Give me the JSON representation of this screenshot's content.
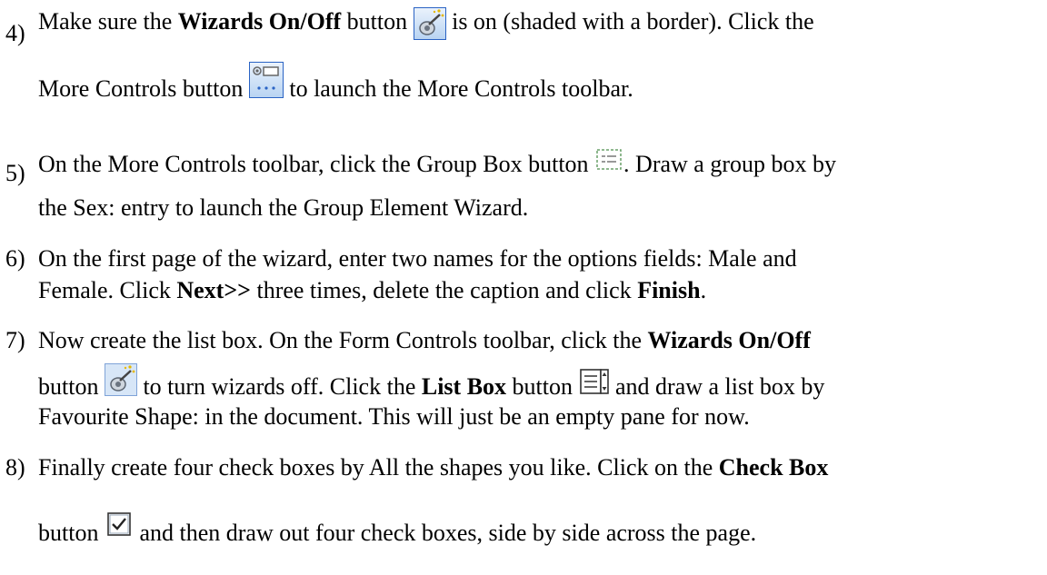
{
  "icons": {
    "wizards": "wizards-on-off-icon",
    "more_controls": "more-controls-icon",
    "group_box": "group-box-icon",
    "list_box": "list-box-icon",
    "check_box": "check-box-icon"
  },
  "colors": {
    "text": "#000000",
    "toolbar_border": "#2a63c4",
    "toolbar_fill": "#c7dcf5"
  },
  "steps": [
    {
      "number": "4)",
      "l1_a": "Make sure the ",
      "l1_b": "Wizards On/Off",
      "l1_c": " button ",
      "l1_d": " is on (shaded with a border). Click the",
      "l2_a": "More Controls button ",
      "l2_b": " to launch the More Controls toolbar."
    },
    {
      "number": "5)",
      "l1_a": "On the More Controls toolbar, click the Group Box button ",
      "l1_b": ". Draw a group box by",
      "l2_a": "the Sex: entry to launch the Group Element Wizard."
    },
    {
      "number": "6)",
      "l1_a": "On the first page of the wizard, enter two names for the options fields: Male and",
      "l2_a": "Female. Click ",
      "l2_b": "Next>>",
      "l2_c": " three times, delete the caption and click ",
      "l2_d": "Finish",
      "l2_e": "."
    },
    {
      "number": "7)",
      "l1_a": "Now create the list box. On the Form Controls toolbar, click the ",
      "l1_b": "Wizards On/Off",
      "l2_a": "button ",
      "l2_b": " to turn wizards off. Click the ",
      "l2_c": "List Box",
      "l2_d": " button ",
      "l2_e": " and draw a list box by",
      "l3_a": "Favourite Shape: in the document. This will just be an empty pane for now."
    },
    {
      "number": "8)",
      "l1_a": "Finally create four check boxes by All the shapes you like. Click on the ",
      "l1_b": "Check Box",
      "l2_a": "button ",
      "l2_b": " and then draw out four check boxes, side by side across the page."
    }
  ]
}
